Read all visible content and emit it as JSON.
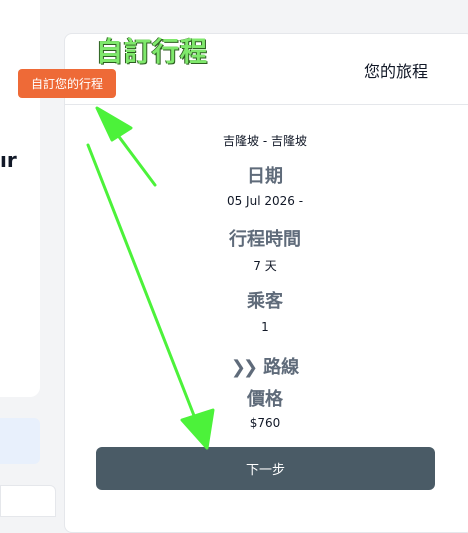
{
  "background": {
    "left_fragment": "ır"
  },
  "overlay": {
    "title": "自訂行程"
  },
  "tag_button": {
    "label": "自訂您的行程",
    "color": "#ee6a37"
  },
  "summary": {
    "title": "您的旅程",
    "route": "吉隆坡 - 吉隆坡",
    "date_label": "日期",
    "date_value": "05 Jul 2026 -",
    "duration_label": "行程時間",
    "duration_value": "7 天",
    "passengers_label": "乘客",
    "passengers_value": "1",
    "itinerary_label": "路線",
    "itinerary_icon": "double-chevron-right-icon",
    "price_label": "價格",
    "price_value": "$760",
    "next_button": "下一步",
    "next_button_color": "#4a5b66"
  },
  "annotations": {
    "arrow_color": "#4cf23a"
  }
}
